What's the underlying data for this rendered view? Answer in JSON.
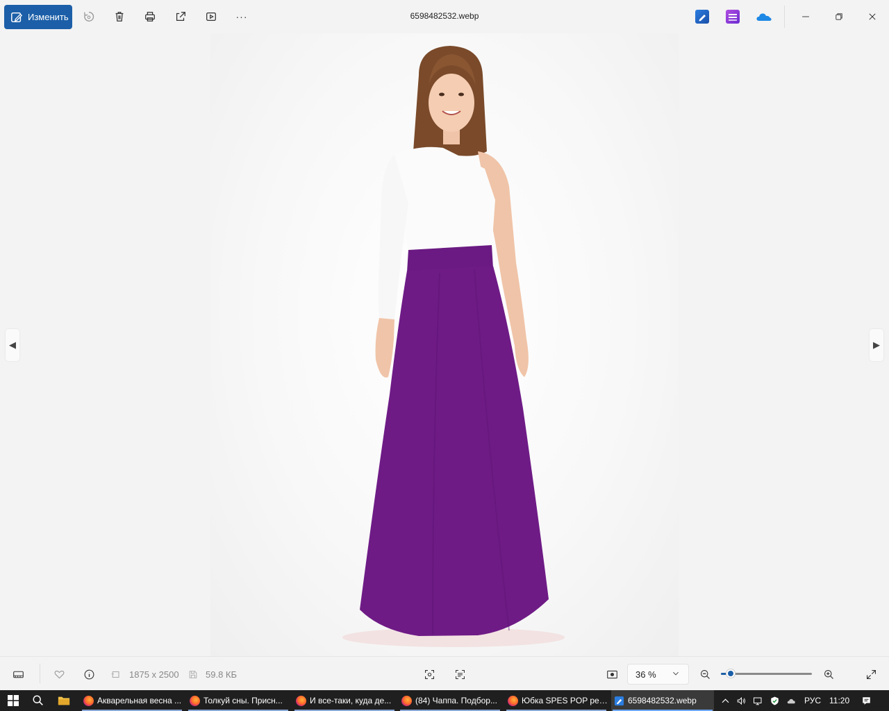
{
  "window": {
    "title": "6598482532.webp"
  },
  "toolbar": {
    "edit_label": "Изменить",
    "more_label": "···"
  },
  "viewer": {
    "photo_description_icon": "photo-icon"
  },
  "statusbar": {
    "dimensions": "1875 x 2500",
    "filesize": "59.8 КБ",
    "zoom": "36 %",
    "zoom_level": 0.11
  },
  "taskbar": {
    "tasks": [
      {
        "label": "Акварельная весна ..."
      },
      {
        "label": "Толкуй сны. Присн..."
      },
      {
        "label": "И все-таки, куда де..."
      },
      {
        "label": "(84) Чаппа. Подбор..."
      },
      {
        "label": "Юбка SPES POP рег..."
      },
      {
        "label": "6598482532.webp"
      }
    ],
    "language": "РУС",
    "time": "11:20"
  },
  "colors": {
    "accent": "#1c5fa8",
    "skirt": "#6e1b86",
    "taskbar": "#1f1f1f"
  }
}
